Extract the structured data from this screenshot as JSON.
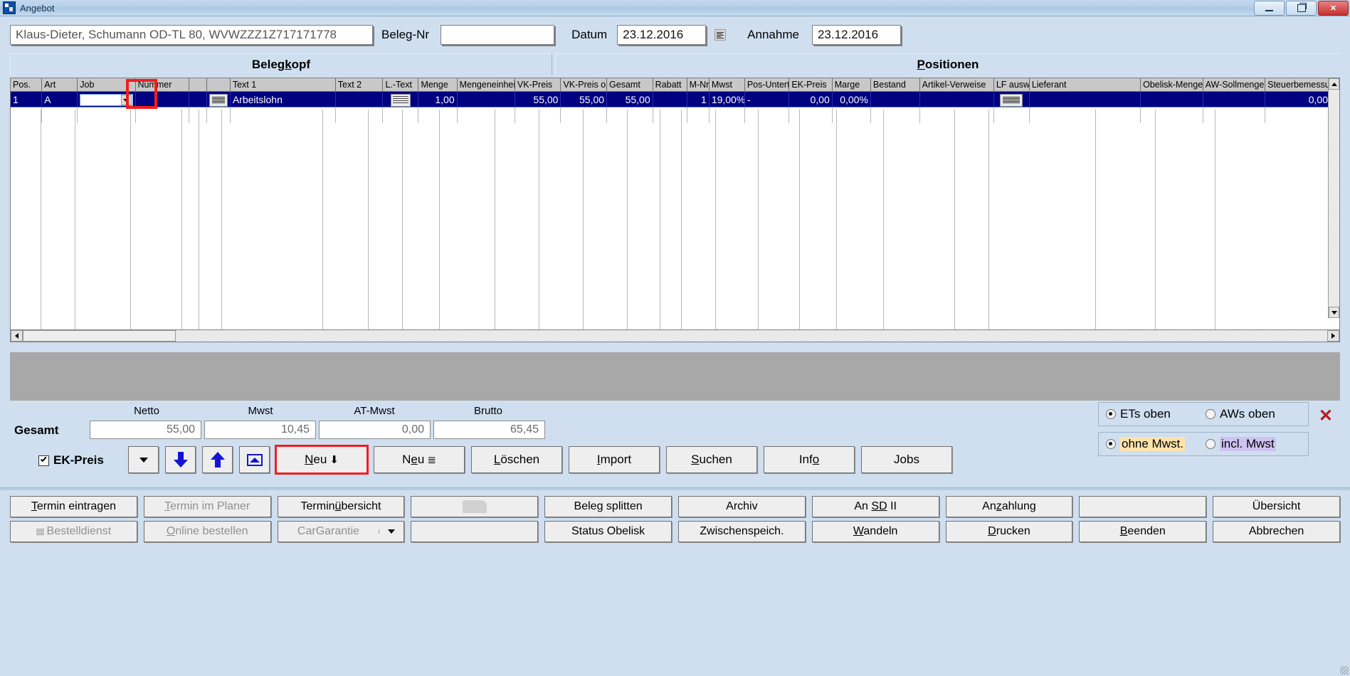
{
  "window": {
    "title": "Angebot",
    "minimize_label": "Minimieren",
    "restore_label": "Wiederherstellen",
    "close_label": "Schließen"
  },
  "header": {
    "customer_value": "Klaus-Dieter, Schumann OD-TL 80, WVWZZZ1Z717171778",
    "beleg_nr_label": "Beleg-Nr",
    "beleg_nr_value": "",
    "datum_label": "Datum",
    "datum_value": "23.12.2016",
    "annahme_label": "Annahme",
    "annahme_value": "23.12.2016",
    "datum_list_icon": "list-icon",
    "annahme_list_icon": "list-icon"
  },
  "tabs": {
    "belegkopf": "Belegkopf",
    "positionen": "Positionen"
  },
  "grid": {
    "columns": [
      "Pos.",
      "Art",
      "Job",
      "Nummer",
      "",
      "",
      "Text 1",
      "Text 2",
      "L.-Text",
      "Menge",
      "Mengeneinheit",
      "VK-Preis",
      "VK-Preis o. Mv",
      "Gesamt",
      "Rabatt",
      "M-Nr",
      "Mwst",
      "Pos-Untertyp",
      "EK-Preis",
      "Marge",
      "Bestand",
      "Artikel-Verweise",
      "LF ausw.",
      "Lieferant",
      "Obelisk-Menge",
      "AW-Sollmenge (Ze",
      "Steuerbemessung"
    ],
    "rows": [
      {
        "pos": "1",
        "art": "A",
        "job": "",
        "nummer": "",
        "spacer": "",
        "text_button": "text-editor-icon",
        "text1": "Arbeitslohn",
        "text2": "",
        "ltext": "long-text-icon",
        "menge": "1,00",
        "mengeneinheit": "",
        "vk_preis": "55,00",
        "vk_preis_o_mwst": "55,00",
        "gesamt": "55,00",
        "rabatt": "",
        "m_nr": "1",
        "mwst": "19,00%",
        "pos_untertyp": "-",
        "ek_preis": "0,00",
        "marge": "0,00%",
        "bestand": "",
        "artikel_verweise": "",
        "lf_ausw": "supplier-select-icon",
        "lieferant": "",
        "obelisk_menge": "",
        "aw_sollmenge": "",
        "steuerbemessung": "0,00"
      }
    ]
  },
  "totals": {
    "gesamt_label": "Gesamt",
    "labels": [
      "Netto",
      "Mwst",
      "AT-Mwst",
      "Brutto"
    ],
    "values": [
      "55,00",
      "10,45",
      "0,00",
      "65,45"
    ]
  },
  "ek_preis": {
    "label": "EK-Preis",
    "checked": true
  },
  "toolbar": {
    "dropdown_icon": "caret-down-icon",
    "move_down_icon": "arrow-down-icon",
    "move_up_icon": "arrow-up-icon",
    "chart_icon": "chart-icon",
    "neu_down_label": "Neu",
    "neu_down_glyph": "⬇",
    "neu_split_label": "Neu",
    "neu_split_glyph": "⤴",
    "loeschen": "Löschen",
    "import": "Import",
    "suchen": "Suchen",
    "info": "Info",
    "jobs": "Jobs"
  },
  "options": {
    "position_group": [
      {
        "label": "ETs oben",
        "selected": true
      },
      {
        "label": "AWs oben",
        "selected": false
      }
    ],
    "mwst_group": [
      {
        "label": "ohne Mwst.",
        "selected": true,
        "highlight": "#fde3ab"
      },
      {
        "label": "incl. Mwst",
        "selected": false,
        "highlight": "#cdc3f0"
      }
    ],
    "close_mark": "✕"
  },
  "bottom_buttons": {
    "row1": [
      {
        "label": "Termin eintragen",
        "disabled": false,
        "accel": "T"
      },
      {
        "label": "Termin im Planer",
        "disabled": true,
        "accel": "T"
      },
      {
        "label": "Terminübersicht",
        "disabled": false,
        "accel": "ü"
      },
      {
        "label": "",
        "disabled": true,
        "icon": "car-icon"
      },
      {
        "label": "Beleg splitten",
        "disabled": false
      },
      {
        "label": "Archiv",
        "disabled": false
      },
      {
        "label": "An SD II",
        "disabled": false,
        "accel": "SD"
      },
      {
        "label": "Anzahlung",
        "disabled": false,
        "accel": "z"
      },
      {
        "label": "",
        "disabled": false
      },
      {
        "label": "Übersicht",
        "disabled": false
      }
    ],
    "row2": [
      {
        "label": "Bestelldienst",
        "disabled": true,
        "icon": "list-small-icon"
      },
      {
        "label": "Online bestellen",
        "disabled": true,
        "accel": "O"
      },
      {
        "label": "CarGarantie",
        "disabled": true,
        "has_dropdown": true
      },
      {
        "label": "",
        "disabled": true
      },
      {
        "label": "Status Obelisk",
        "disabled": false
      },
      {
        "label": "Zwischenspeich.",
        "disabled": false
      },
      {
        "label": "Wandeln",
        "disabled": false,
        "accel": "W"
      },
      {
        "label": "Drucken",
        "disabled": false,
        "accel": "D"
      },
      {
        "label": "Beenden",
        "disabled": false,
        "accel": "B"
      },
      {
        "label": "Abbrechen",
        "disabled": false
      }
    ]
  },
  "colors": {
    "window_bg": "#cfdff0",
    "selection": "#000080",
    "highlight_box": "#f21d1d",
    "grey_panel": "#a8a8a8",
    "header_grey": "#c8c8c8"
  }
}
